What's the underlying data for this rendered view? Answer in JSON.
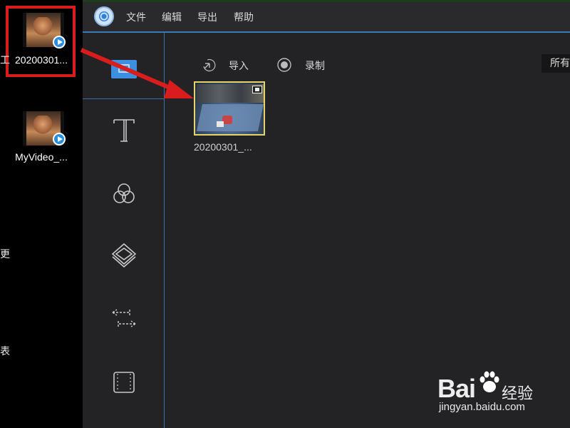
{
  "desktop": {
    "icons": [
      {
        "label": "20200301..."
      },
      {
        "label": "MyVideo_..."
      }
    ],
    "edge_chars": [
      "工",
      "更",
      "表"
    ]
  },
  "app": {
    "menu": [
      "文件",
      "编辑",
      "导出",
      "帮助"
    ],
    "toolbar": {
      "import_label": "导入",
      "record_label": "录制",
      "sort_label": "所有"
    },
    "rail_icons": [
      "media-icon",
      "text-icon",
      "filter-icon",
      "overlay-icon",
      "transition-icon",
      "element-icon"
    ],
    "media": [
      {
        "name": "20200301_..."
      }
    ]
  },
  "watermark": {
    "brand_a": "Bai",
    "brand_b": "经验",
    "url": "jingyan.baidu.com"
  },
  "colors": {
    "accent": "#3d8fe0",
    "highlight_red": "#d91c1c",
    "selection_yellow": "#e6d36a",
    "app_bg": "#232325"
  }
}
